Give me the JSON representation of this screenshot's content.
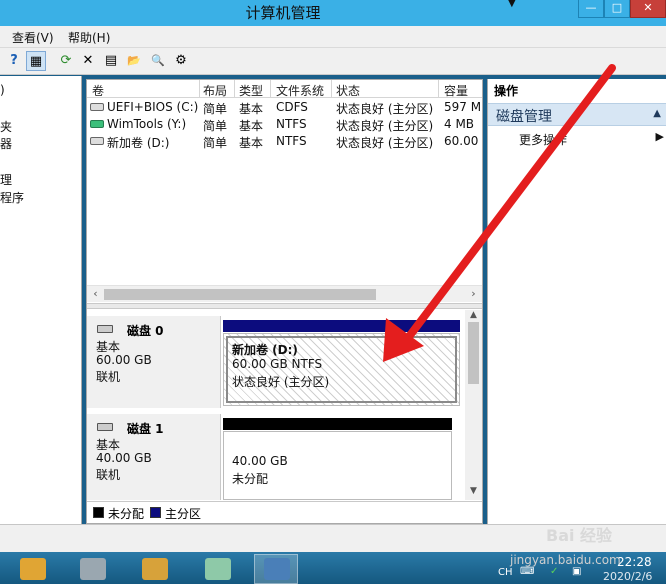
{
  "window": {
    "title": "计算机管理"
  },
  "menu": {
    "items": [
      "查看(V)",
      "帮助(H)"
    ]
  },
  "toolbar": {
    "icons": [
      "help-icon",
      "panel-icon",
      "refresh-icon",
      "delete-icon",
      "properties-icon",
      "open-folder-icon",
      "search-icon",
      "settings-icon"
    ],
    "glyphs": [
      "?",
      "▦",
      "⟳",
      "✕",
      "▤",
      "📂",
      "🔍",
      "⚙"
    ]
  },
  "left_tree": {
    "items": [
      ")",
      "夹",
      "器",
      "理",
      "程序"
    ]
  },
  "volumes": {
    "headers": [
      "卷",
      "布局",
      "类型",
      "文件系统",
      "状态",
      "容量"
    ],
    "rows": [
      {
        "name": "UEFI+BIOS (C:)",
        "layout": "简单",
        "type": "基本",
        "fs": "CDFS",
        "status": "状态良好 (主分区)",
        "capacity": "597 M"
      },
      {
        "name": "WimTools (Y:)",
        "layout": "简单",
        "type": "基本",
        "fs": "NTFS",
        "status": "状态良好 (主分区)",
        "capacity": "4 MB"
      },
      {
        "name": "新加卷 (D:)",
        "layout": "简单",
        "type": "基本",
        "fs": "NTFS",
        "status": "状态良好 (主分区)",
        "capacity": "60.00"
      }
    ]
  },
  "disks": [
    {
      "name": "磁盘 0",
      "type": "基本",
      "size": "60.00 GB",
      "state": "联机",
      "partition": {
        "title": "新加卷  (D:)",
        "detail": "60.00 GB NTFS",
        "status": "状态良好 (主分区)"
      }
    },
    {
      "name": "磁盘 1",
      "type": "基本",
      "size": "40.00 GB",
      "state": "联机",
      "partition": {
        "size": "40.00 GB",
        "status": "未分配"
      }
    }
  ],
  "legend": {
    "unallocated": "未分配",
    "primary": "主分区"
  },
  "actions": {
    "title": "操作",
    "section": "磁盘管理",
    "more": "更多操作"
  },
  "colors": {
    "primary_partition": "#0c0c7e",
    "unallocated": "#000000",
    "selection_bg": "#d7e6f4",
    "titlebar": "#3ab0e6"
  },
  "taskbar": {
    "ime": "CH",
    "time": "22:28",
    "date": "2020/2/6"
  },
  "watermark": {
    "brand": "Bai 经验",
    "url": "jingyan.baidu.com"
  }
}
